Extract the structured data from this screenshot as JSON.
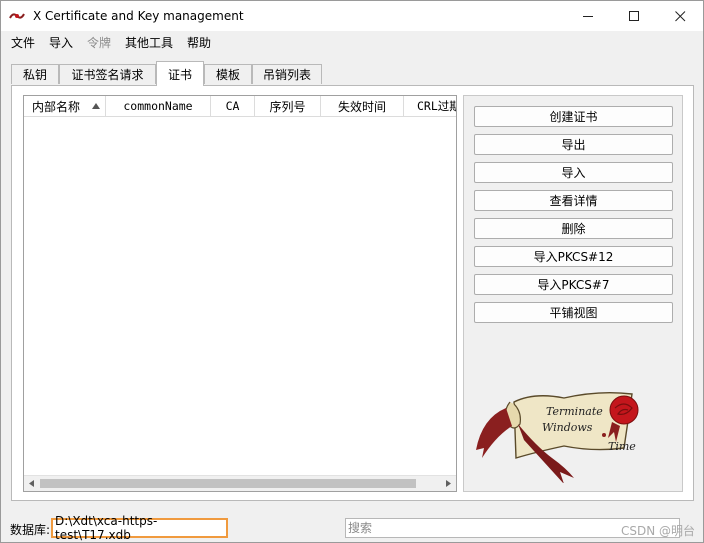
{
  "window": {
    "title": "X Certificate and Key management",
    "controls": {
      "minimize": "—",
      "maximize": "☐",
      "close": "✕"
    }
  },
  "menu": {
    "items": [
      {
        "label": "文件",
        "enabled": true
      },
      {
        "label": "导入",
        "enabled": true
      },
      {
        "label": "令牌",
        "enabled": false
      },
      {
        "label": "其他工具",
        "enabled": true
      },
      {
        "label": "帮助",
        "enabled": true
      }
    ]
  },
  "tabs": {
    "items": [
      "私钥",
      "证书签名请求",
      "证书",
      "模板",
      "吊销列表"
    ],
    "active": "证书"
  },
  "table": {
    "columns": [
      "内部名称",
      "commonName",
      "CA",
      "序列号",
      "失效时间",
      "CRL过期"
    ],
    "sort_column": "内部名称",
    "sort_direction": "ascending",
    "rows": []
  },
  "actions": {
    "buttons": [
      "创建证书",
      "导出",
      "导入",
      "查看详情",
      "删除",
      "导入PKCS#12",
      "导入PKCS#7",
      "平铺视图"
    ]
  },
  "logo": {
    "text_line1": "Terminate",
    "text_line2": "Windows",
    "text_line3": "Time",
    "colors": {
      "parchment": "#efe6c6",
      "ribbon": "#8a1f1f",
      "seal": "#c4161c"
    }
  },
  "status": {
    "db_label": "数据库:",
    "db_path": "D:\\Xdt\\xca-https-test\\T17.xdb",
    "search_placeholder": "搜索",
    "watermark": "CSDN @明台"
  }
}
